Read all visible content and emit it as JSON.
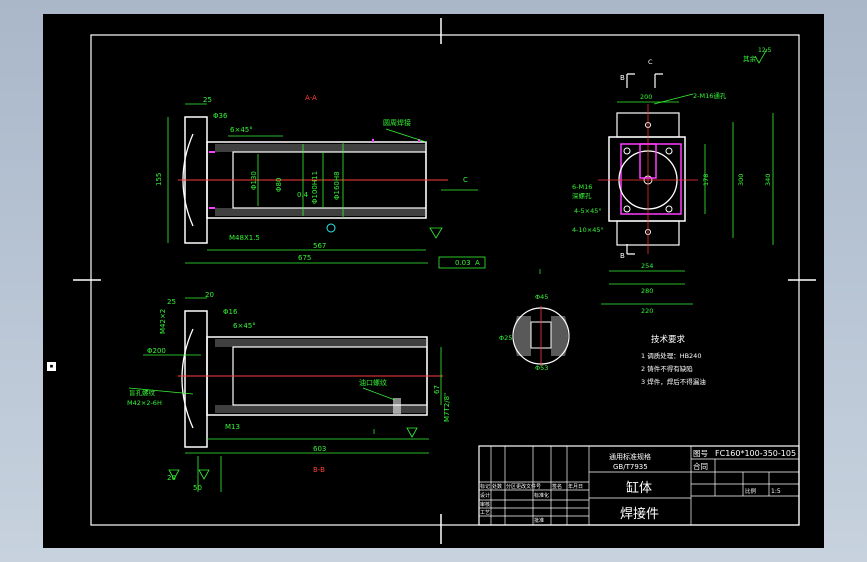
{
  "drawing": {
    "views": {
      "section_aa": "A-A",
      "section_bb": "B-B",
      "view_c": "C",
      "detail_i": "I",
      "section_mark_b": "B",
      "section_mark_a": "A"
    },
    "title_block": {
      "standard_line1": "通用标准规格",
      "standard_line2": "GB/T7935",
      "part_name": "缸体",
      "process": "焊接件",
      "drawing_no_label": "图号",
      "drawing_no": "FC160*100-350-105",
      "contract_label": "合同",
      "small_labels": [
        "标记",
        "处数",
        "分区",
        "更改文件号",
        "签名",
        "年月日",
        "设计",
        "标准化",
        "审核",
        "工艺",
        "批准"
      ],
      "scale_label": "比例",
      "scale": "1:5"
    },
    "technical_requirements": {
      "title": "技术要求",
      "items": [
        "1 调质处理：HB240",
        "2 铸件不得有缺陷",
        "3 焊件，焊后不得漏油"
      ]
    },
    "dimensions": {
      "aa": [
        "25",
        "Φ36",
        "6×45°",
        "155",
        "Φ130",
        "Φ80",
        "Φ100H11",
        "0.4",
        "Φ160H8",
        "M48X1.5",
        "567",
        "675",
        "0.03",
        "A"
      ],
      "bb": [
        "25",
        "20",
        "Φ16",
        "6×45°",
        "Φ200",
        "M42×2",
        "M13",
        "603",
        "67",
        "M7T2/8\"",
        "20",
        "50"
      ],
      "c_view": [
        "200",
        "2-M16通孔",
        "178",
        "300",
        "340",
        "254",
        "280",
        "220",
        "6-M16",
        "深螺孔",
        "4-5×45°",
        "4-10×45°"
      ],
      "detail": [
        "Φ45",
        "Φ53",
        "Φ25"
      ]
    },
    "annotations": {
      "aa_weld_note": "圆周焊接",
      "bb_oil_port": "油口螺纹",
      "bb_left_note1": "盲孔螺纹",
      "bb_left_note2": "M42×2-6H",
      "roughness": "12.5",
      "roughness_note": "其余"
    }
  }
}
